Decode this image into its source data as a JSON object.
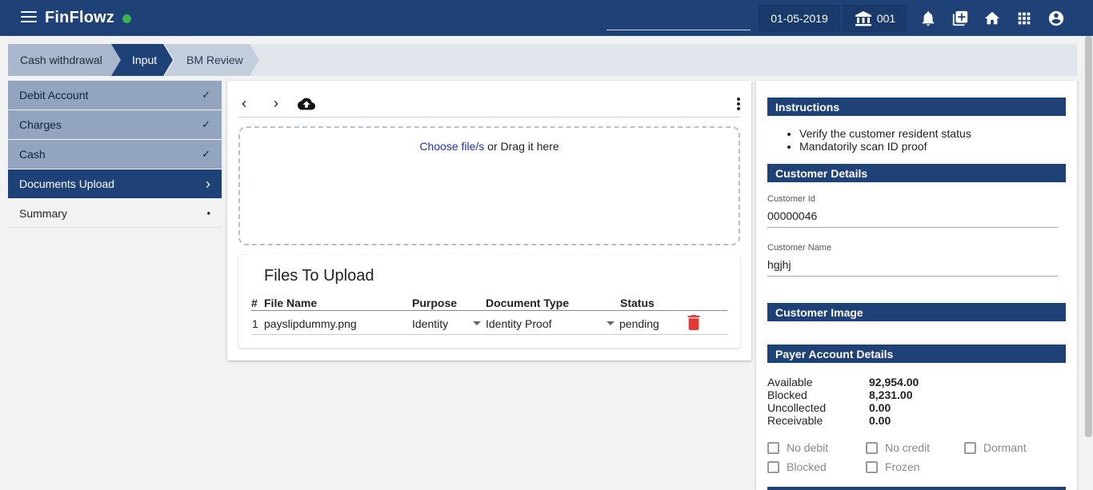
{
  "app": {
    "title": "FinFlowz",
    "status_color": "#3bb54a",
    "primary_color": "#1e4178"
  },
  "header": {
    "search_value": "",
    "date": "01-05-2019",
    "branch": "001",
    "icons": [
      "bell-icon",
      "add-box-icon",
      "home-icon",
      "apps-grid-icon",
      "account-circle-icon"
    ]
  },
  "breadcrumb": {
    "steps": [
      {
        "label": "Cash withdrawal",
        "state": "done"
      },
      {
        "label": "Input",
        "state": "active"
      },
      {
        "label": "BM Review",
        "state": "pending"
      }
    ]
  },
  "sidebar": {
    "items": [
      {
        "label": "Debit Account",
        "mark": "✓",
        "state": "done"
      },
      {
        "label": "Charges",
        "mark": "✓",
        "state": "done"
      },
      {
        "label": "Cash",
        "mark": "✓",
        "state": "done"
      },
      {
        "label": "Documents Upload",
        "mark": "›",
        "state": "active"
      },
      {
        "label": "Summary",
        "mark": "•",
        "state": "pending"
      }
    ]
  },
  "upload": {
    "toolbar_icons": [
      "chevron-left-icon",
      "chevron-right-icon",
      "cloud-upload-icon",
      "more-vertical-icon"
    ],
    "dropzone": {
      "choose_text": "Choose file/s",
      "rest_text": " or Drag it here"
    },
    "files_title": "Files To Upload",
    "columns": [
      "#",
      "File Name",
      "Purpose",
      "Document Type",
      "Status"
    ],
    "rows": [
      {
        "num": "1",
        "file_name": "payslipdummy.png",
        "purpose": "Identity",
        "document_type": "Identity Proof",
        "status": "pending"
      }
    ]
  },
  "right_panel": {
    "instructions_title": "Instructions",
    "instructions": [
      "Verify the customer resident status",
      "Mandatorily scan ID proof"
    ],
    "customer_details_title": "Customer Details",
    "customer_id_label": "Customer Id",
    "customer_id": "00000046",
    "customer_name_label": "Customer Name",
    "customer_name": "hgjhj",
    "customer_image_title": "Customer Image",
    "payer_title": "Payer Account Details",
    "balances": [
      {
        "label": "Available",
        "value": "92,954.00"
      },
      {
        "label": "Blocked",
        "value": "8,231.00"
      },
      {
        "label": "Uncollected",
        "value": "0.00"
      },
      {
        "label": "Receivable",
        "value": "0.00"
      }
    ],
    "flags": [
      {
        "label": "No debit",
        "checked": false
      },
      {
        "label": "No credit",
        "checked": false
      },
      {
        "label": "Dormant",
        "checked": false
      },
      {
        "label": "Blocked",
        "checked": false
      },
      {
        "label": "Frozen",
        "checked": false
      }
    ]
  }
}
